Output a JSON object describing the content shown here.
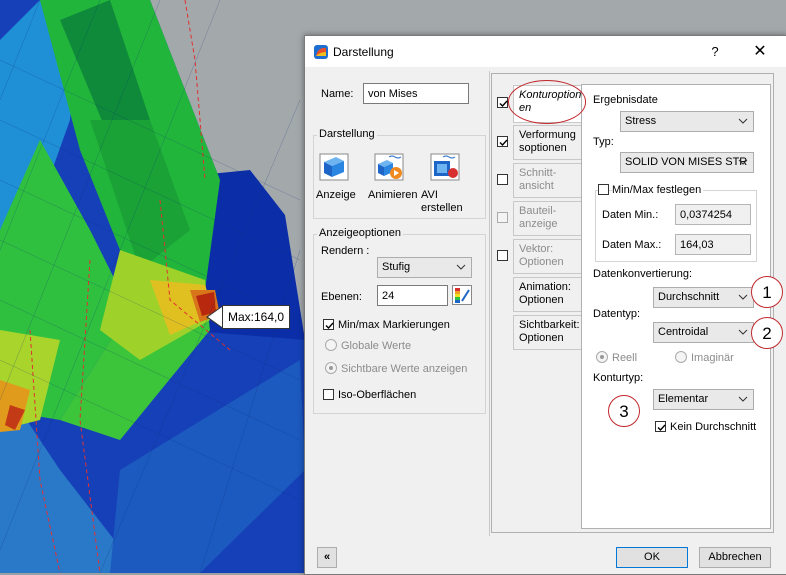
{
  "viewport": {
    "max_label": "Max:164,0"
  },
  "dialog": {
    "title": "Darstellung",
    "help_label": "?",
    "close_label": "✕",
    "name_label": "Name:",
    "name_value": "von Mises",
    "darstellung_group": "Darstellung",
    "buttons": {
      "anzeige": "Anzeige",
      "animieren": "Animieren",
      "avi_line1": "AVI",
      "avi_line2": "erstellen"
    },
    "anzeigeoptionen": {
      "group_label": "Anzeigeoptionen",
      "rendern_label": "Rendern :",
      "rendern_value": "Stufig",
      "ebenen_label": "Ebenen:",
      "ebenen_value": "24",
      "minmax_markierungen": "Min/max Markierungen",
      "globale_werte": "Globale Werte",
      "sichtbare_werte": "Sichtbare Werte anzeigen",
      "iso_oberflaechen": "Iso-Oberflächen"
    },
    "tabs": [
      {
        "line1": "Konturoption",
        "line2": "en"
      },
      {
        "line1": "Verformung",
        "line2": "soptionen"
      },
      {
        "line1": "Schnitt-",
        "line2": "ansicht"
      },
      {
        "line1": "Bauteil-",
        "line2": "anzeige"
      },
      {
        "line1": "Vektor:",
        "line2": "Optionen"
      },
      {
        "line1": "Animation:",
        "line2": "Optionen"
      },
      {
        "line1": "Sichtbarkeit:",
        "line2": "Optionen"
      }
    ],
    "kontur": {
      "ergebnisdate_label": "Ergebnisdate",
      "ergebnisdate_value": "Stress",
      "typ_label": "Typ:",
      "typ_value": "SOLID VON MISES STR",
      "minmax_festlegen": "Min/Max festlegen",
      "daten_min_label": "Daten Min.:",
      "daten_min_value": "0,0374254",
      "daten_max_label": "Daten Max.:",
      "daten_max_value": "164,03",
      "datenkonvertierung_label": "Datenkonvertierung:",
      "datenkonvertierung_value": "Durchschnitt",
      "datentyp_label": "Datentyp:",
      "datentyp_value": "Centroidal",
      "reell": "Reell",
      "imaginaer": "Imaginär",
      "konturtyp_label": "Konturtyp:",
      "konturtyp_value": "Elementar",
      "kein_durchschnitt": "Kein Durchschnitt"
    },
    "annotations": [
      "1",
      "2",
      "3"
    ],
    "ok_label": "OK",
    "cancel_label": "Abbrechen",
    "collapse_label": "«"
  },
  "colors": {
    "annotation_red": "#c0282c",
    "focus_blue": "#0078d7"
  }
}
